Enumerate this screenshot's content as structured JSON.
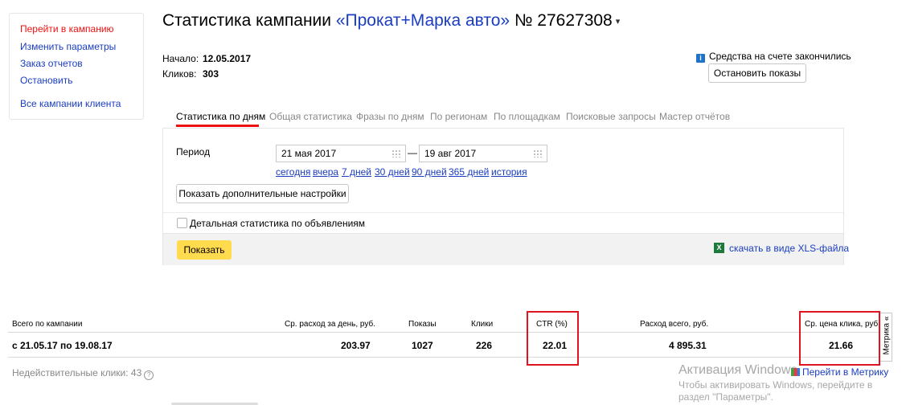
{
  "sidebar": {
    "items": [
      {
        "label": "Перейти в кампанию",
        "active": true
      },
      {
        "label": "Изменить параметры"
      },
      {
        "label": "Заказ отчетов"
      },
      {
        "label": "Остановить"
      },
      {
        "label": "Все кампании клиента"
      }
    ]
  },
  "header": {
    "title_prefix": "Статистика кампании",
    "campaign_name": "«Прокат+Марка авто»",
    "campaign_number": "№ 27627308",
    "caret": "▾"
  },
  "meta": {
    "start_label": "Начало:",
    "start_value": "12.05.2017",
    "clicks_label": "Кликов:",
    "clicks_value": "303"
  },
  "notice": {
    "icon": "i",
    "text": "Средства на счете закончились",
    "stop_button": "Остановить показы"
  },
  "tabs": [
    {
      "label": "Статистика по дням",
      "active": true
    },
    {
      "label": "Общая статистика"
    },
    {
      "label": "Фразы по дням"
    },
    {
      "label": "По регионам"
    },
    {
      "label": "По площадкам"
    },
    {
      "label": "Поисковые запросы"
    },
    {
      "label": "Мастер отчётов"
    }
  ],
  "filters": {
    "period_label": "Период",
    "date_from": "21 мая 2017",
    "date_to": "19 авг 2017",
    "dash": "—",
    "quick_ranges": [
      "сегодня",
      "вчера",
      "7 дней",
      "30 дней",
      "90 дней",
      "365 дней",
      "история"
    ],
    "more_settings_button": "Показать дополнительные настройки",
    "detailed_checkbox_label": "Детальная статистика по объявлениям",
    "detailed_checked": false,
    "show_button": "Показать",
    "xls_icon": "X",
    "xls_link": "скачать в виде XLS-файла"
  },
  "stats": {
    "headers": {
      "total": "Всего по кампании",
      "avg_daily_spend": "Ср. расход за день, руб.",
      "impressions": "Показы",
      "clicks": "Клики",
      "ctr": "CTR (%)",
      "total_spend": "Расход всего, руб.",
      "avg_cpc": "Ср. цена клика, руб."
    },
    "row": {
      "period": "с 21.05.17 по 19.08.17",
      "avg_daily_spend": "203.97",
      "impressions": "1027",
      "clicks": "226",
      "ctr": "22.01",
      "total_spend": "4 895.31",
      "avg_cpc": "21.66"
    },
    "metrika_tab": "Метрика «",
    "invalid_clicks": "Недействительные клики: 43",
    "help_icon": "?",
    "metrika_link": "Перейти в Метрику",
    "highlight_color": "#e0141e"
  },
  "watermark": {
    "title": "Активация Windows",
    "text": "Чтобы активировать Windows, перейдите в раздел \"Параметры\"."
  }
}
